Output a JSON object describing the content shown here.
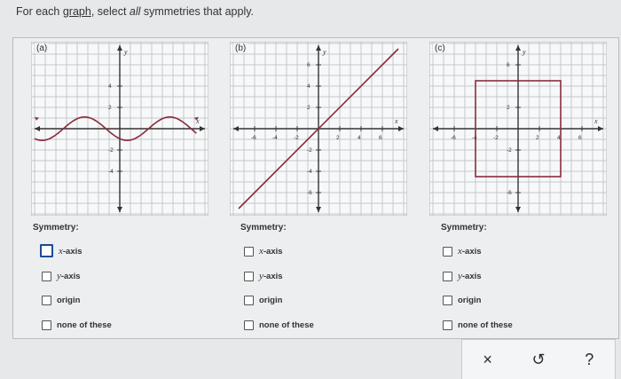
{
  "instruction": {
    "prefix": "For each",
    "link": "graph",
    "mid": ", select",
    "emph": "all",
    "suffix": "symmetries that apply."
  },
  "graphs": [
    {
      "id": "a",
      "label": "(a)",
      "x_ticks": [],
      "y_ticks": [
        "4",
        "2",
        "-2",
        "-4"
      ],
      "x_axis_label": "x",
      "y_axis_label": "y"
    },
    {
      "id": "b",
      "label": "(b)",
      "x_ticks": [
        "-6",
        "-4",
        "-2",
        "2",
        "4",
        "6"
      ],
      "y_ticks": [
        "6",
        "4",
        "2",
        "-2",
        "-4",
        "-6"
      ],
      "x_axis_label": "x",
      "y_axis_label": "y"
    },
    {
      "id": "c",
      "label": "(c)",
      "x_ticks": [
        "-6",
        "-4",
        "-2",
        "2",
        "4",
        "6"
      ],
      "y_ticks": [
        "6",
        "2",
        "-2",
        "-6"
      ],
      "x_axis_label": "x",
      "y_axis_label": "y"
    }
  ],
  "symmetry": {
    "title": "Symmetry:",
    "options": {
      "x_axis": {
        "var": "x",
        "word": "-axis"
      },
      "y_axis": {
        "var": "y",
        "word": "-axis"
      },
      "origin": "origin",
      "none": "none of these"
    }
  },
  "colors": {
    "curve": "#8a2c3c",
    "grid": "#c4c7cb",
    "axis": "#333333",
    "focus": "#1d4b96"
  },
  "toolbar": {
    "clear_icon": "×",
    "undo_icon": "↺",
    "help_icon": "?"
  }
}
